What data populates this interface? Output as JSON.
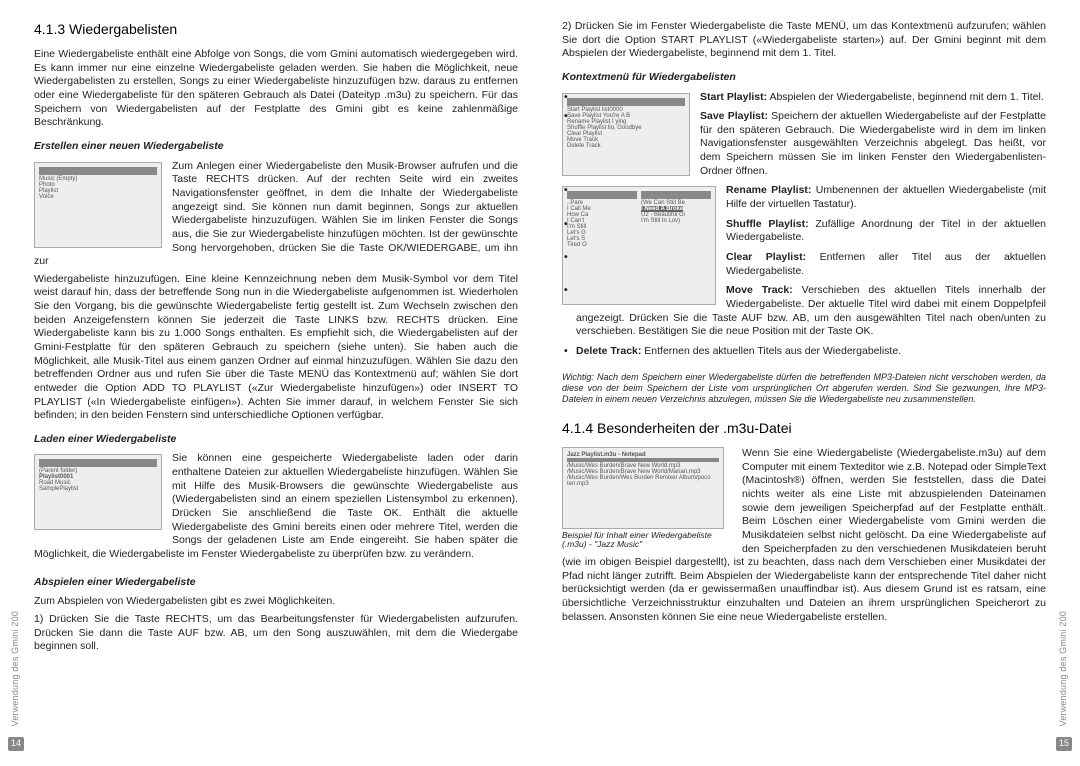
{
  "left": {
    "title": "4.1.3 Wiedergabelisten",
    "intro": "Eine Wiedergabeliste enthält eine Abfolge von Songs, die vom Gmini automatisch wiedergegeben wird. Es kann immer nur eine einzelne Wiedergabeliste geladen werden. Sie haben die Möglichkeit, neue Wiedergabelisten zu erstellen, Songs zu einer Wiedergabeliste hinzuzufügen bzw. daraus zu entfernen oder eine Wiedergabeliste für den späteren Gebrauch als Datei (Dateityp .m3u) zu speichern. Für das Speichern von Wiedergabelisten auf der Festplatte des Gmini gibt es keine zahlenmäßige Beschränkung.",
    "sub1_title": "Erstellen einer neuen Wiedergabeliste",
    "sub1_p1": "Zum Anlegen einer Wiedergabeliste den Musik-Browser aufrufen und die Taste RECHTS drücken. Auf der rechten Seite wird ein zweites Navigationsfenster geöffnet, in dem die Inhalte der Wiedergabeliste angezeigt sind. Sie können nun damit beginnen, Songs zur aktuellen Wiedergabeliste hinzuzufügen. Wählen Sie im linken Fenster die Songs aus, die Sie zur Wiedergabeliste hinzufügen möchten. Ist der gewünschte Song hervorgehoben, drücken Sie die Taste OK/WIEDERGABE, um ihn zur",
    "sub1_p2": "Wiedergabeliste hinzuzufügen. Eine kleine Kennzeichnung neben dem Musik-Symbol vor dem Titel weist darauf hin, dass der betreffende Song nun in die Wiedergabeliste aufgenommen ist. Wiederholen Sie den Vorgang, bis die gewünschte Wiedergabeliste fertig gestellt ist. Zum Wechseln zwischen den beiden Anzeigefenstern können Sie jederzeit die Taste LINKS bzw. RECHTS drücken. Eine Wiedergabeliste kann bis zu 1.000 Songs enthalten. Es empfiehlt sich, die Wiedergabelisten auf der Gmini-Festplatte für den späteren Gebrauch zu speichern (siehe unten). Sie haben auch die Möglichkeit, alle Musik-Titel aus einem ganzen Ordner auf einmal hinzuzufügen. Wählen Sie dazu den betreffenden Ordner aus und rufen Sie über die Taste MENÜ das Kontextmenü auf; wählen Sie dort entweder die Option ADD TO PLAYLIST («Zur Wiedergabeliste hinzufügen») oder INSERT TO PLAYLIST («In Wiedergabeliste einfügen»). Achten Sie immer darauf, in welchem Fenster Sie sich befinden; in den beiden Fenstern sind unterschiedliche Optionen verfügbar.",
    "sub2_title": "Laden einer Wiedergabeliste",
    "sub2_p1": "Sie können eine gespeicherte Wiedergabeliste laden oder darin enthaltene Dateien zur aktuellen Wiedergabeliste hinzufügen. Wählen Sie mit Hilfe des Musik-Browsers die gewünschte Wiedergabeliste aus (Wiedergabelisten sind an einem speziellen Listensymbol zu erkennen). Drücken Sie anschließend die Taste OK. Enthält die aktuelle Wiedergabeliste des Gmini bereits einen oder mehrere Titel, werden die Songs der geladenen Liste am Ende eingereiht. Sie haben später die Möglichkeit, die Wiedergabeliste im Fenster Wiedergabeliste zu überprüfen bzw. zu verändern.",
    "sub3_title": "Abspielen einer Wiedergabeliste",
    "sub3_p1": "Zum Abspielen von Wiedergabelisten gibt es zwei Möglichkeiten.",
    "sub3_p2": "1) Drücken Sie die Taste RECHTS, um das Bearbeitungsfenster für Wiedergabelisten aufzurufen. Drücken Sie dann die Taste AUF bzw. AB, um den Song auszuwählen, mit dem die Wiedergabe beginnen soll.",
    "sidebar": "Verwendung des Gmini 200",
    "pageno": "14"
  },
  "right": {
    "p0": "2) Drücken Sie im Fenster Wiedergabeliste die Taste MENÜ, um das Kontextmenü aufzurufen; wählen Sie dort die Option START PLAYLIST («Wiedergabeliste starten») auf. Der Gmini beginnt mit dem Abspielen der Wiedergabeliste, beginnend mit dem 1. Titel.",
    "ctx_title": "Kontextmenü für Wiedergabelisten",
    "items": [
      {
        "label": "Start Playlist:",
        "text": " Abspielen der Wiedergabeliste, beginnend mit dem 1. Titel."
      },
      {
        "label": "Save Playlist:",
        "text": " Speichern der aktuellen Wiedergabeliste auf der Festplatte für den späteren Gebrauch. Die Wiedergabeliste wird in dem im linken Navigationsfenster ausgewählten Verzeichnis abgelegt. Das heißt, vor dem Speichern müssen Sie im linken Fenster den Wiedergabenlisten-Ordner öffnen."
      },
      {
        "label": "Rename Playlist:",
        "text": " Umbenennen der aktuellen Wiedergabeliste (mit Hilfe der virtuellen Tastatur)."
      },
      {
        "label": "Shuffle Playlist:",
        "text": " Zufällige Anordnung der Titel in der aktuellen Wiedergabeliste."
      },
      {
        "label": "Clear Playlist:",
        "text": " Entfernen aller Titel aus der aktuellen Wiedergabeliste."
      },
      {
        "label": "Move Track:",
        "text": " Verschieben des aktuellen Titels innerhalb der Wiedergabeliste. Der aktuelle Titel wird dabei mit einem Doppelpfeil angezeigt. Drücken Sie die Taste AUF bzw. AB, um den ausgewählten Titel nach oben/unten zu verschieben. Bestätigen Sie die neue Position mit der Taste OK."
      },
      {
        "label": "Delete Track:",
        "text": " Entfernen des aktuellen Titels aus der Wiedergabeliste."
      }
    ],
    "note": "Wichtig: Nach dem Speichern einer Wiedergabeliste dürfen die betreffenden MP3-Dateien nicht verschoben werden, da diese von der beim Speichern der Liste vom ursprünglichen Ort abgerufen werden. Sind Sie gezwungen, Ihre MP3-Dateien in einem neuen Verzeichnis abzulegen, müssen Sie die Wiedergabeliste neu zusammenstellen.",
    "sec2_title": "4.1.4 Besonderheiten der .m3u-Datei",
    "sec2_caption": "Beispiel für Inhalt einer Wiedergabeliste (.m3u) - \"Jazz Music\"",
    "sec2_p": "Wenn Sie eine Wiedergabeliste (Wiedergabeliste.m3u) auf dem Computer mit einem Texteditor wie z.B. Notepad oder SimpleText (Macintosh®) öffnen, werden Sie feststellen, dass die Datei nichts weiter als eine Liste mit abzuspielenden Dateinamen sowie dem jeweiligen Speicherpfad auf der Festplatte enthält. Beim Löschen einer Wiedergabeliste vom Gmini werden die Musikdateien selbst nicht gelöscht. Da eine Wiedergabeliste auf den Speicherpfaden zu den verschiedenen Musikdateien beruht (wie im obigen Beispiel dargestellt), ist zu beachten, dass nach dem Verschieben einer Musikdatei der Pfad nicht länger zutrifft. Beim Abspielen der Wiedergabeliste kann der entsprechende Titel daher nicht berücksichtigt werden (da er gewissermaßen unauffindbar ist). Aus diesem Grund ist es ratsam, eine übersichtliche Verzeichnisstruktur einzuhalten und Dateien an ihrem ursprünglichen Speicherort zu belassen. Ansonsten können Sie eine neue Wiedergabeliste erstellen.",
    "sidebar": "Verwendung des Gmini 200",
    "pageno": "15"
  },
  "mock_img": {
    "img1_lines": [
      "Music            (Empty)",
      "Photo",
      "Playlist",
      "Voice"
    ],
    "img2_lines": [
      "(Parent folder)",
      "Playlist0001",
      "Road Music",
      "SamplePlaylist"
    ],
    "img3_lines": [
      "Start Playlist  list0000",
      "Save Playlist  You're A B",
      "Rename Playlist I ying",
      "Shuffle Playlist llo, Goodbye",
      "Clear Playlist",
      "Move Track",
      "Delete Track"
    ],
    "img4_left": [
      "..Pare",
      "I Call Me",
      "How Ca",
      "I Can't",
      "I'm Still",
      "Let's G",
      "Let's S",
      "Tired O"
    ],
    "img4_right": [
      "(We Can Still Be",
      "I Need A Broke",
      "U2 - Beautiful Gi",
      "I'm Still In Lov)"
    ],
    "img5_lines": [
      "Jazz Playlist.m3u - Notepad",
      "/Music/Wes Burden/Brave New World.mp3",
      "/Music/Wes Burden/Brave New World/Marian.mp3",
      "/Music/Wes Burden/Wes Burden Remixer Album/poco ten.mp3"
    ]
  }
}
